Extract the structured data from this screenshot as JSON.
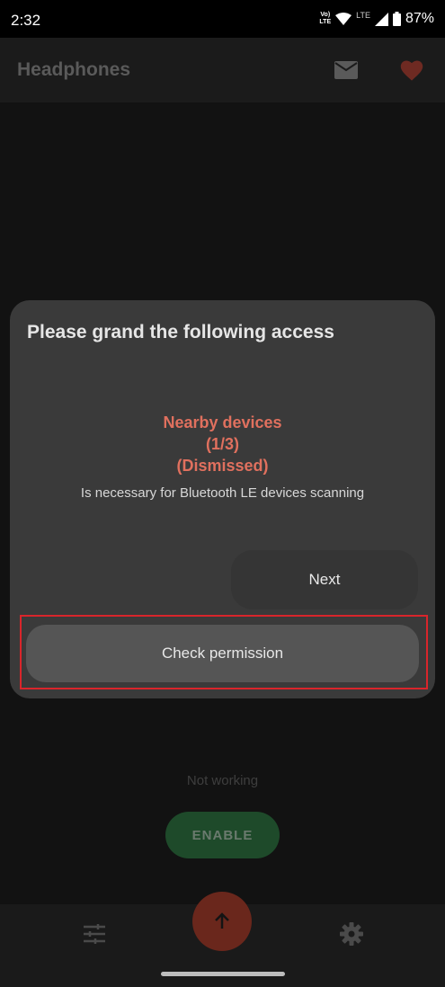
{
  "status_bar": {
    "time": "2:32",
    "volte_top": "Vo)",
    "volte_bottom": "LTE",
    "lte": "LTE",
    "battery": "87%"
  },
  "app_bar": {
    "title": "Headphones"
  },
  "dialog": {
    "title": "Please grand the following access",
    "permission_name": "Nearby devices",
    "permission_count": "(1/3)",
    "permission_status": "(Dismissed)",
    "permission_description": "Is necessary for Bluetooth LE devices scanning",
    "next_label": "Next",
    "check_label": "Check permission"
  },
  "main": {
    "status_text": "Not working",
    "enable_label": "ENABLE"
  },
  "colors": {
    "accent_red": "#e0705e",
    "fab": "#6a271c",
    "enable_green": "#1e4a2a",
    "highlight": "#d9252b"
  },
  "icons": [
    "mail-icon",
    "heart-icon",
    "tune-icon",
    "arrow-up-icon",
    "gear-icon",
    "wifi-icon",
    "signal-icon",
    "battery-icon"
  ]
}
